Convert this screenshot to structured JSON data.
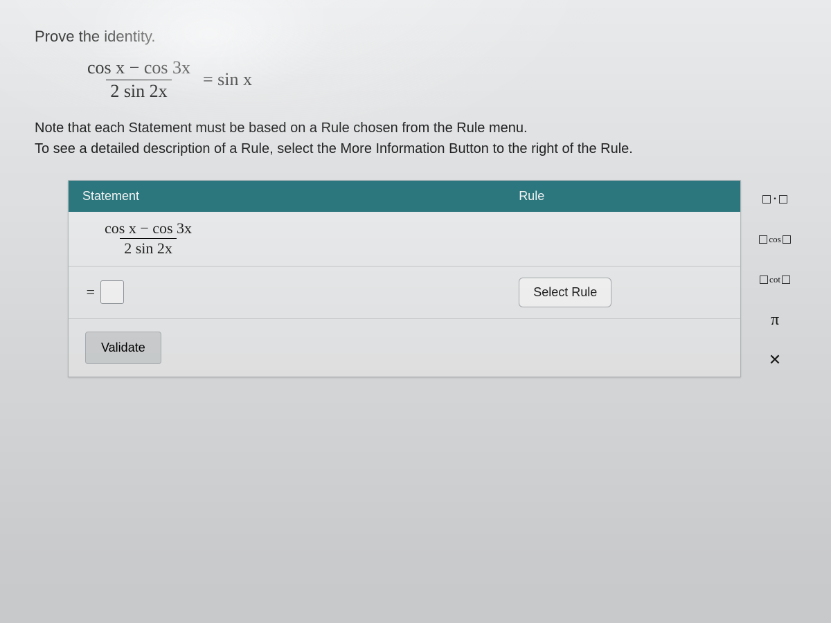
{
  "prompt": {
    "title": "Prove the identity.",
    "identity_numerator": "cos x − cos 3x",
    "identity_denominator": "2 sin 2x",
    "identity_equals": "= sin x",
    "note_line1": "Note that each Statement must be based on a Rule chosen from the Rule menu.",
    "note_line2": "To see a detailed description of a Rule, select the More Information Button to the right of the Rule."
  },
  "panel": {
    "header_statement": "Statement",
    "header_rule": "Rule",
    "row1_numerator": "cos x − cos 3x",
    "row1_denominator": "2 sin 2x",
    "row2_prefix": "=",
    "select_rule_label": "Select Rule",
    "validate_label": "Validate"
  },
  "palette": {
    "item1_left_box": "□",
    "item1_dot": "·",
    "item1_right_box": "□",
    "item2_left_box": "□",
    "item2_fn": "cos",
    "item2_right_box": "□",
    "item3_left_box": "□",
    "item3_fn": "cot",
    "item3_right_box": "□",
    "item4_pi": "π",
    "item5_x": "✕"
  }
}
